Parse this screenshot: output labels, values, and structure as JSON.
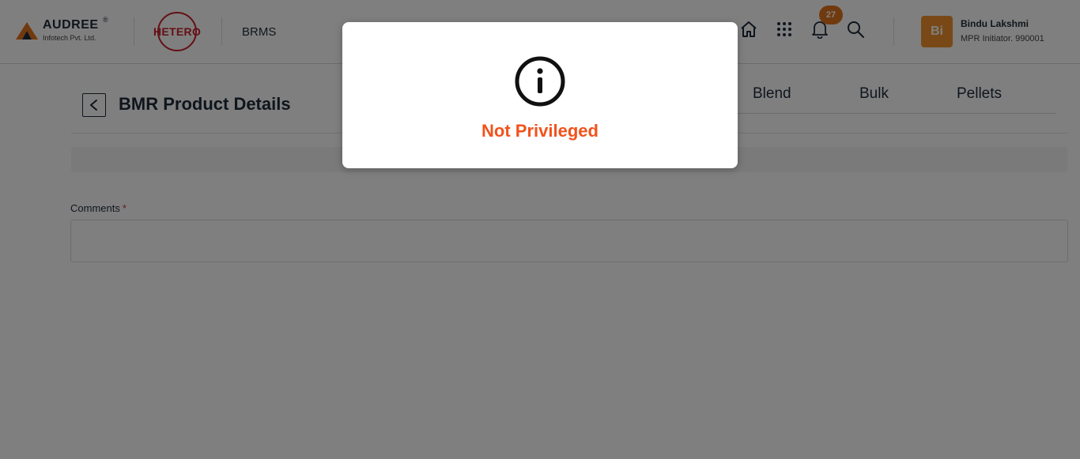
{
  "header": {
    "brand_name": "AUDREE",
    "brand_reg": "®",
    "brand_sub": "Infotech Pvt. Ltd.",
    "partner_name": "HETERO",
    "app_name": "BRMS",
    "icons": [
      "home-icon",
      "apps-grid-icon",
      "bell-icon",
      "search-icon"
    ],
    "notification_count": "27",
    "user": {
      "initials": "Bi",
      "name": "Bindu Lakshmi",
      "role": "MPR Initiator. 990001"
    }
  },
  "page": {
    "title": "BMR Product Details",
    "tabs": [
      "Blend",
      "Bulk",
      "Pellets"
    ],
    "comments_label": "Comments",
    "required_marker": "*",
    "comments_value": ""
  },
  "modal": {
    "icon": "info-icon",
    "message": "Not Privileged"
  },
  "colors": {
    "accent_orange": "#f0531c",
    "badge": "#e2741d",
    "avatar": "#f0922d",
    "partner_red": "#c9202a",
    "overlay": "rgba(0,0,0,0.5)"
  }
}
